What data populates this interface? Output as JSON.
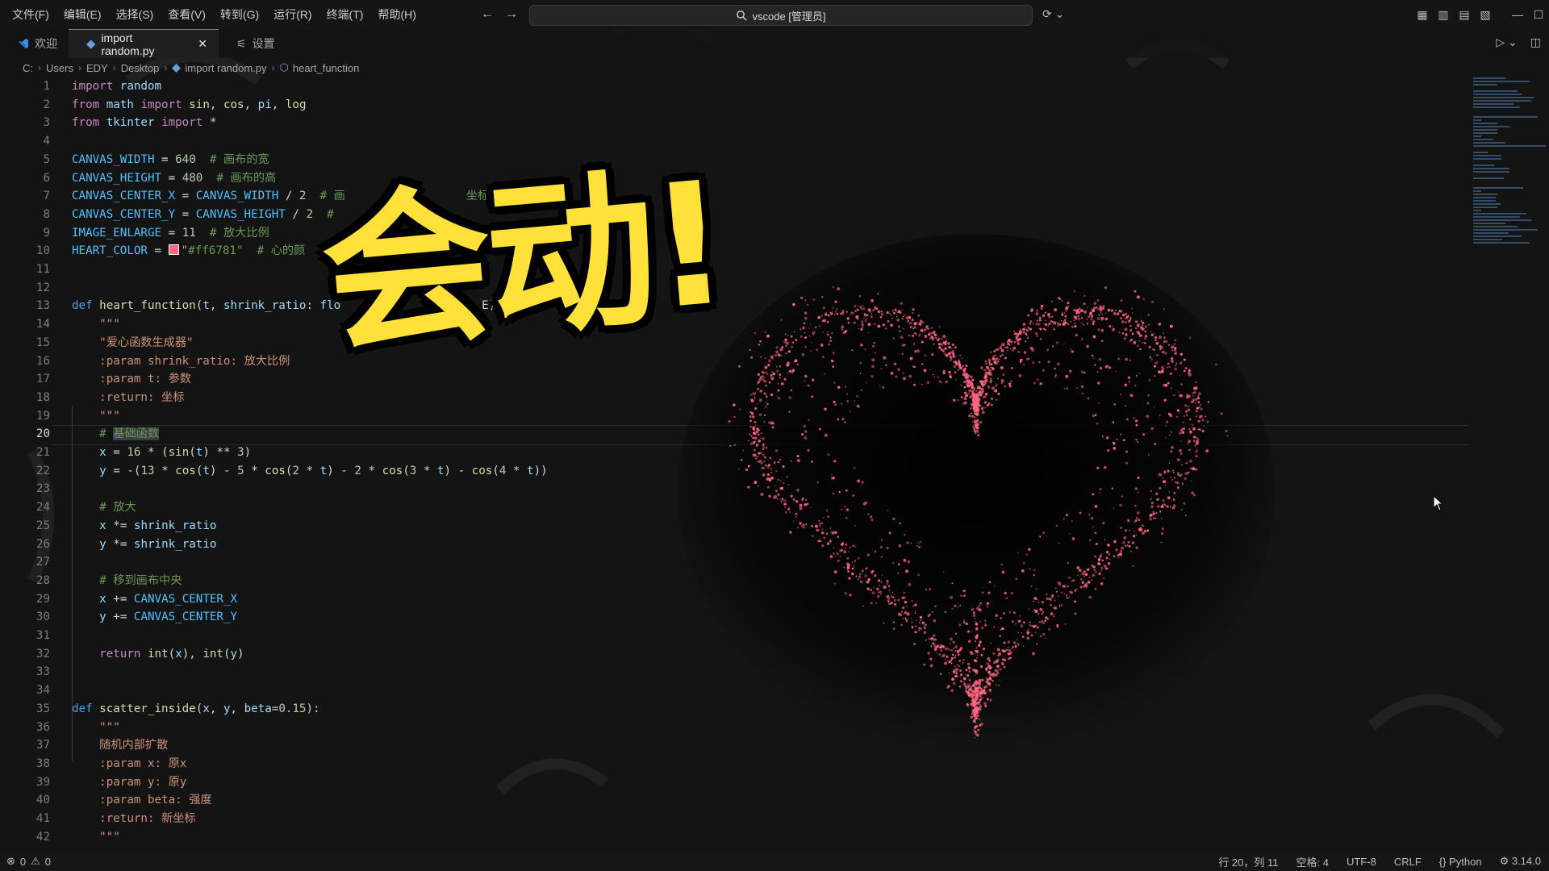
{
  "titlebar": {
    "menus": [
      "文件(F)",
      "编辑(E)",
      "选择(S)",
      "查看(V)",
      "转到(G)",
      "运行(R)",
      "终端(T)",
      "帮助(H)"
    ],
    "search_text": "vscode [管理员]"
  },
  "tabs": [
    {
      "label": "欢迎",
      "icon": "vscode-icon",
      "active": false
    },
    {
      "label": "import random.py",
      "icon": "python-icon",
      "active": true
    },
    {
      "label": "设置",
      "icon": "settings-icon",
      "active": false
    }
  ],
  "breadcrumb": [
    "C:",
    "Users",
    "EDY",
    "Desktop",
    "import random.py",
    "heart_function"
  ],
  "editor": {
    "current_line": 20,
    "lines": [
      "import random",
      "from math import sin, cos, pi, log",
      "from tkinter import *",
      "",
      "CANVAS_WIDTH = 640  # 画布的宽",
      "CANVAS_HEIGHT = 480  # 画布的高",
      "CANVAS_CENTER_X = CANVAS_WIDTH / 2  # 画",
      "CANVAS_CENTER_Y = CANVAS_HEIGHT / 2  #",
      "IMAGE_ENLARGE = 11  # 放大比例",
      "HEART_COLOR = \"#ff6781\"  # 心的颜",
      "",
      "",
      "def heart_function(t, shrink_ratio: flo",
      "    \"\"\"",
      "    \"爱心函数生成器\"",
      "    :param shrink_ratio: 放大比例",
      "    :param t: 参数",
      "    :return: 坐标",
      "    \"\"\"",
      "    # 基础函数",
      "    x = 16 * (sin(t) ** 3)",
      "    y = -(13 * cos(t) - 5 * cos(2 * t) - 2 * cos(3 * t) - cos(4 * t))",
      "",
      "    # 放大",
      "    x *= shrink_ratio",
      "    y *= shrink_ratio",
      "",
      "    # 移到画布中央",
      "    x += CANVAS_CENTER_X",
      "    y += CANVAS_CENTER_Y",
      "",
      "    return int(x), int(y)",
      "",
      "",
      "def scatter_inside(x, y, beta=0.15):",
      "    \"\"\"",
      "    随机内部扩散",
      "    :param x: 原x",
      "    :param y: 原y",
      "    :param beta: 强度",
      "    :return: 新坐标",
      "    \"\"\""
    ],
    "partial_fragments": {
      "line7_tail": "坐标",
      "line13_tail": "E):"
    }
  },
  "overlay": {
    "title": "会动!",
    "title_color": "#ffe13a",
    "heart_color": "#ff6781"
  },
  "statusbar": {
    "errors": "0",
    "warnings": "0",
    "position": "行 20，列 11",
    "spaces": "空格: 4",
    "encoding": "UTF-8",
    "eol": "CRLF",
    "language": "Python",
    "version": "3.14.0"
  }
}
